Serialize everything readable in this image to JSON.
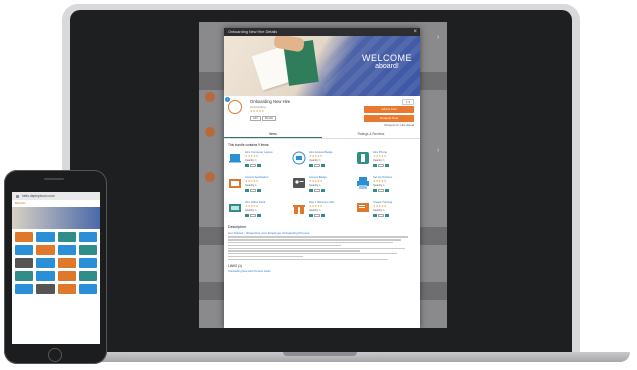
{
  "modal": {
    "title": "Onboarding New Hire Details",
    "close": "×",
    "hero_line1": "WELCOME",
    "hero_line2": "aboard!",
    "name": "Onboarding New Hire",
    "tag1": "Add",
    "tag2": "Bundle",
    "btn1": "Add to Cart",
    "btn2": "Request Now",
    "request_text": "Request for: Hire Actual",
    "tabs": [
      "Items",
      "Ratings & Reviews"
    ],
    "bundle_title": "This bundle contains 9 items:",
    "items": [
      {
        "name": "Hire Computer Laptop",
        "qty": "Quantity: 1",
        "icon": "laptop-icon",
        "color": "#2a8fd6"
      },
      {
        "name": "Hire Access Badge",
        "qty": "Quantity: 1",
        "icon": "badge-icon",
        "color": "#2a8fd6"
      },
      {
        "name": "Hire Phone",
        "qty": "Quantity: 1",
        "icon": "phone-icon",
        "color": "#2f8f88"
      },
      {
        "name": "Access Application",
        "qty": "Quantity: 1",
        "icon": "app-icon",
        "color": "#e0782c"
      },
      {
        "name": "Access Badge",
        "qty": "Quantity: 1",
        "icon": "id-card-icon",
        "color": "#555555"
      },
      {
        "name": "Set Up Printers",
        "qty": "Quantity: 1",
        "icon": "printer-icon",
        "color": "#2a8fd6"
      },
      {
        "name": "Hire Office Desk",
        "qty": "Quantity: 1",
        "icon": "desk-icon",
        "color": "#2f8f88"
      },
      {
        "name": "Day 1 Welcome Gift",
        "qty": "Quantity: 1",
        "icon": "gift-icon",
        "color": "#e0782c"
      },
      {
        "name": "Create Training",
        "qty": "Quantity: 1",
        "icon": "training-icon",
        "color": "#e0782c"
      }
    ],
    "desc_heading": "Description",
    "desc_subheading": "Get Started - Streamline your Employee Onboarding Process",
    "links_heading": "LINKS (1)",
    "link1": "Onboarding New Hire Process Guide"
  },
  "phone": {
    "url": "hello.deployIxcon.com",
    "logo": "BRAND"
  },
  "colors": {
    "accent": "#e8792e",
    "teal": "#2f8f88",
    "link": "#2a7bd0"
  }
}
